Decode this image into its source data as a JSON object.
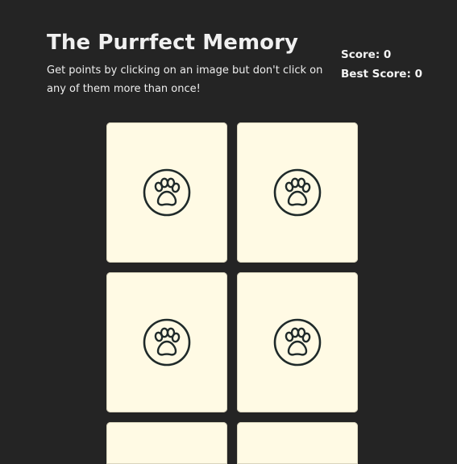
{
  "header": {
    "title": "The Purrfect Memory",
    "subtitle": "Get points by clicking on an image but don't click on any of them more than once!"
  },
  "scoreboard": {
    "score_label": "Score:",
    "score_value": "0",
    "best_label": "Best Score:",
    "best_value": "0"
  },
  "cards": [
    {
      "icon": "paw-icon"
    },
    {
      "icon": "paw-icon"
    },
    {
      "icon": "paw-icon"
    },
    {
      "icon": "paw-icon"
    },
    {
      "icon": "paw-icon"
    },
    {
      "icon": "paw-icon"
    }
  ],
  "colors": {
    "background": "#242424",
    "card": "#fffae4",
    "icon": "#1f2a2a"
  }
}
